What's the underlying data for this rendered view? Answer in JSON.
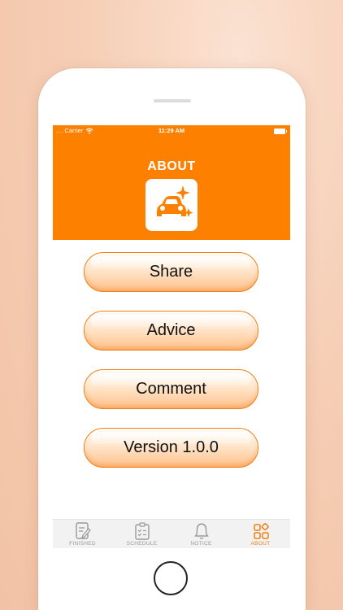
{
  "status_bar": {
    "carrier": ".... Carrier",
    "time": "11:29 AM"
  },
  "header": {
    "title": "ABOUT",
    "app_icon": "car-sparkle-icon"
  },
  "buttons": [
    {
      "label": "Share"
    },
    {
      "label": "Advice"
    },
    {
      "label": "Comment"
    },
    {
      "label": "Version 1.0.0"
    }
  ],
  "tabs": [
    {
      "label": "FINISHED",
      "icon": "edit-document-icon"
    },
    {
      "label": "SCHEDULE",
      "icon": "checklist-clipboard-icon"
    },
    {
      "label": "NOTICE",
      "icon": "bell-icon"
    },
    {
      "label": "ABOUT",
      "icon": "grid-squares-icon",
      "active": true
    }
  ],
  "colors": {
    "accent": "#fd8000",
    "active_tab": "#f07f10",
    "inactive_tab": "#9a9a9a"
  }
}
